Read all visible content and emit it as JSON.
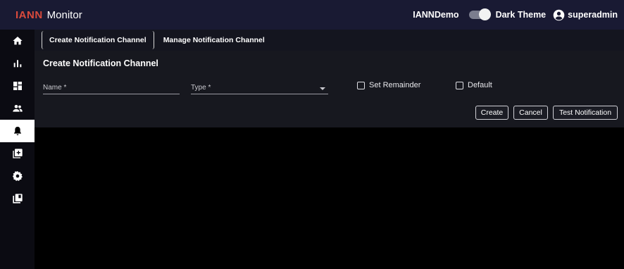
{
  "header": {
    "logo_text": "IANN",
    "app_title": "Monitor",
    "org_name": "IANNDemo",
    "theme_label": "Dark Theme",
    "theme_toggle_on": true,
    "user_name": "superadmin"
  },
  "sidebar": {
    "items": [
      {
        "name": "home-icon",
        "active": false
      },
      {
        "name": "bar-chart-icon",
        "active": false
      },
      {
        "name": "dashboard-icon",
        "active": false
      },
      {
        "name": "users-icon",
        "active": false
      },
      {
        "name": "bell-icon",
        "active": true
      },
      {
        "name": "add-box-icon",
        "active": false
      },
      {
        "name": "gear-icon",
        "active": false
      },
      {
        "name": "library-icon",
        "active": false
      }
    ]
  },
  "tabs": {
    "create": "Create Notification Channel",
    "manage": "Manage Notification Channel"
  },
  "form": {
    "title": "Create Notification Channel",
    "name_label": "Name *",
    "type_label": "Type *",
    "set_remainder_label": "Set Remainder",
    "set_remainder_checked": false,
    "default_label": "Default",
    "default_checked": false
  },
  "buttons": {
    "create": "Create",
    "cancel": "Cancel",
    "test": "Test Notification"
  },
  "colors": {
    "topbar_bg": "#191a33",
    "logo_accent": "#d94a3c",
    "active_nav_bg": "#ffffff",
    "page_bg": "#000000"
  }
}
